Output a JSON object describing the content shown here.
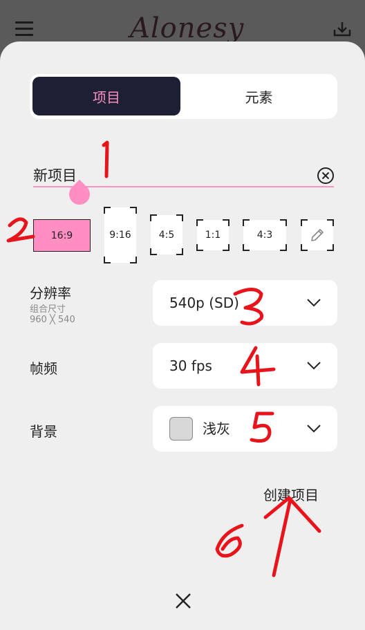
{
  "header": {
    "logo_text": "Alonesy",
    "menu_icon": "menu-icon",
    "download_icon": "download-icon"
  },
  "tabs": [
    {
      "label": "项目",
      "active": true
    },
    {
      "label": "元素",
      "active": false
    }
  ],
  "project_name": {
    "value": "新项目",
    "clear_icon": "clear-circle-icon"
  },
  "aspect_ratios": [
    {
      "label": "16:9",
      "selected": true
    },
    {
      "label": "9:16",
      "selected": false
    },
    {
      "label": "4:5",
      "selected": false
    },
    {
      "label": "1:1",
      "selected": false
    },
    {
      "label": "4:3",
      "selected": false
    },
    {
      "label": "",
      "icon": "pencil-icon",
      "selected": false
    }
  ],
  "resolution": {
    "label": "分辨率",
    "sub_label": "组合尺寸",
    "size": "960 ╳ 540",
    "value": "540p (SD)"
  },
  "frame_rate": {
    "label": "帧频",
    "value": "30 fps"
  },
  "background": {
    "label": "背景",
    "value": "浅灰",
    "swatch_color": "#d8d8d8"
  },
  "actions": {
    "create_label": "创建项目",
    "close_icon": "close-icon"
  },
  "annotations": [
    "1",
    "2",
    "3",
    "4",
    "5",
    "6"
  ],
  "colors": {
    "accent": "#ff8ec2",
    "active_tab_bg": "#1d2035",
    "annotation": "#e8141c"
  }
}
